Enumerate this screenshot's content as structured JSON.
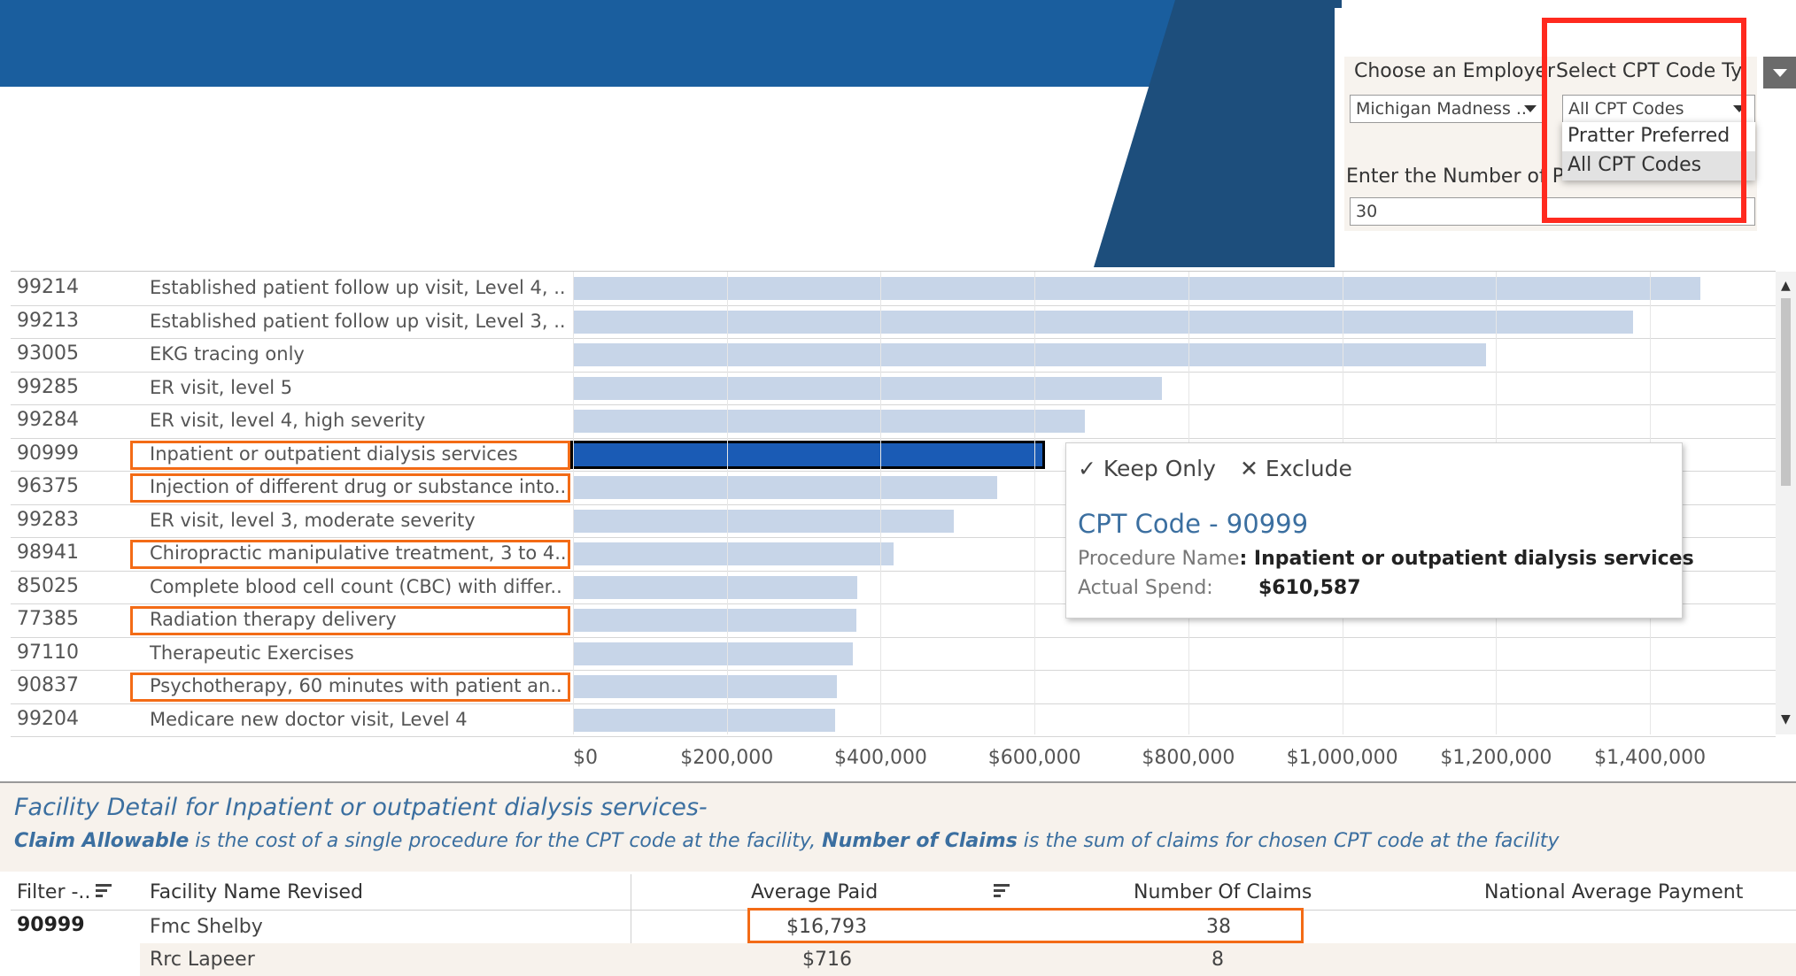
{
  "filters": {
    "employer_label": "Choose an Employer",
    "employer_value": "Michigan Madness ..",
    "cpt_type_label": "Select CPT Code Typ",
    "cpt_type_value": "All CPT Codes",
    "cpt_type_options": [
      "Pratter Preferred",
      "All CPT Codes"
    ],
    "num_procedures_label": "Enter the Number of Procedures to Display",
    "num_procedures_value": "30"
  },
  "chart_data": {
    "type": "bar",
    "orientation": "horizontal",
    "categories": [
      {
        "code": "99214",
        "name": "Established patient follow up visit, Level 4, .."
      },
      {
        "code": "99213",
        "name": "Established patient follow up visit, Level 3, .."
      },
      {
        "code": "93005",
        "name": "EKG tracing only"
      },
      {
        "code": "99285",
        "name": "ER visit, level 5"
      },
      {
        "code": "99284",
        "name": "ER visit, level 4, high severity"
      },
      {
        "code": "90999",
        "name": "Inpatient or outpatient dialysis services"
      },
      {
        "code": "96375",
        "name": "Injection of different drug or substance into.."
      },
      {
        "code": "99283",
        "name": "ER visit, level 3, moderate severity"
      },
      {
        "code": "98941",
        "name": "Chiropractic manipulative treatment, 3 to 4.."
      },
      {
        "code": "85025",
        "name": "Complete blood cell count (CBC) with differ.."
      },
      {
        "code": "77385",
        "name": "Radiation therapy delivery"
      },
      {
        "code": "97110",
        "name": "Therapeutic Exercises"
      },
      {
        "code": "90837",
        "name": "Psychotherapy, 60 minutes with patient an.."
      },
      {
        "code": "99204",
        "name": "Medicare new doctor visit, Level 4"
      }
    ],
    "values": [
      1465000,
      1378000,
      1187000,
      766000,
      665000,
      610587,
      551000,
      495000,
      417000,
      370000,
      368000,
      364000,
      343000,
      341000
    ],
    "selected_index": 5,
    "highlighted_names": [
      5,
      6,
      8,
      10,
      12
    ],
    "xlim": [
      0,
      1500000
    ],
    "x_ticks": [
      "$0",
      "$200,000",
      "$400,000",
      "$600,000",
      "$800,000",
      "$1,000,000",
      "$1,200,000",
      "$1,400,000"
    ],
    "x_tick_values": [
      0,
      200000,
      400000,
      600000,
      800000,
      1000000,
      1200000,
      1400000
    ],
    "bar_color": "#c7d5e8",
    "selected_color": "#1a5bb5"
  },
  "tooltip": {
    "keep_only": "Keep Only",
    "exclude": "Exclude",
    "title": "CPT Code - 90999",
    "procedure_label": "Procedure Name",
    "procedure_value": ": Inpatient or outpatient dialysis services",
    "spend_label": "Actual Spend:",
    "spend_value": "$610,587"
  },
  "detail": {
    "title": "Facility Detail for Inpatient or outpatient dialysis services-",
    "desc_term1": "Claim Allowable",
    "desc_part1": " is the cost of a single procedure for the CPT code at the facility, ",
    "desc_term2": "Number of Claims",
    "desc_part2": " is the sum of claims for chosen CPT code at the facility",
    "columns": [
      "Filter -..",
      "Facility Name Revised",
      "Average Paid",
      "Number Of Claims",
      "National Average Payment"
    ],
    "filter_value": "90999",
    "rows": [
      {
        "facility": "Fmc Shelby",
        "avg_paid": "$16,793",
        "claims": "38"
      },
      {
        "facility": "Rrc Lapeer",
        "avg_paid": "$716",
        "claims": "8"
      }
    ]
  },
  "colors": {
    "header_blue": "#1a5e9e",
    "header_dark": "#1d4e7c",
    "annotation_red": "#ff2a1f",
    "annotation_orange": "#f36b16",
    "link_blue": "#3b6fa0"
  }
}
